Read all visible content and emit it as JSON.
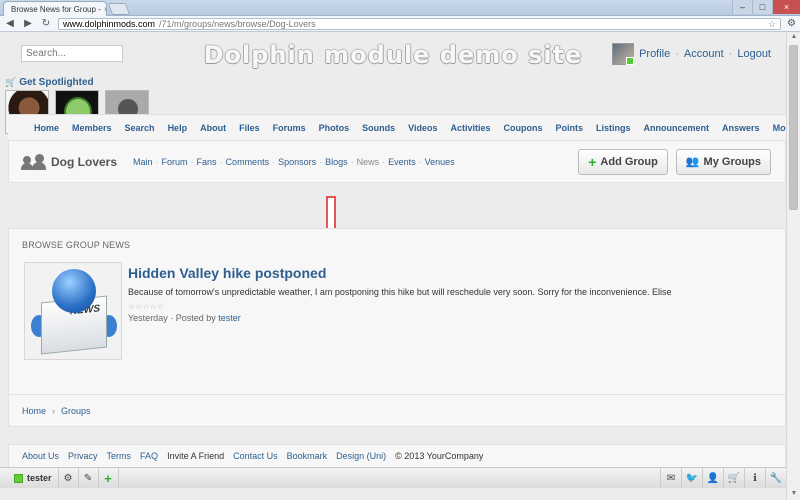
{
  "browser": {
    "tab_title": "Browse News for Group -",
    "tab_close": "×",
    "url_host": "www.dolphinmods.com",
    "url_path": "/71/m/groups/news/browse/Dog-Lovers",
    "window_min": "–",
    "window_max": "□",
    "window_close": "×"
  },
  "header": {
    "search_placeholder": "Search...",
    "site_title": "Dolphin module demo site",
    "user_menu": [
      "Profile",
      "Account",
      "Logout"
    ]
  },
  "spotlight": {
    "title": "Get Spotlighted"
  },
  "main_nav": [
    "Home",
    "Members",
    "Search",
    "Help",
    "About",
    "Files",
    "Forums",
    "Photos",
    "Sounds",
    "Videos",
    "Activities",
    "Coupons",
    "Points",
    "Listings",
    "Announcement",
    "Answers",
    "More"
  ],
  "group": {
    "name": "Dog Lovers",
    "tabs": [
      "Main",
      "Forum",
      "Fans",
      "Comments",
      "Sponsors",
      "Blogs",
      "News",
      "Events",
      "Venues"
    ],
    "active_tab": "News",
    "buttons": {
      "add_group": "Add Group",
      "my_groups": "My Groups"
    }
  },
  "news_box": {
    "title": "BROWSE GROUP NEWS",
    "item": {
      "title": "Hidden Valley hike postponed",
      "text": "Because of tomorrow's unpredictable weather, I am postponing this hike but will reschedule very soon. Sorry for the inconvenience. Elise",
      "rating": "☆☆☆☆☆",
      "meta_when": "Yesterday",
      "meta_posted_by": "Posted by",
      "meta_author": "tester"
    }
  },
  "breadcrumb": [
    "Home",
    "Groups"
  ],
  "footer": {
    "links": [
      "About Us",
      "Privacy",
      "Terms",
      "FAQ",
      "Invite A Friend",
      "Contact Us",
      "Bookmark",
      "Design (Uni)"
    ],
    "copyright": "© 2013 YourCompany"
  },
  "toolbar": {
    "username": "tester"
  }
}
